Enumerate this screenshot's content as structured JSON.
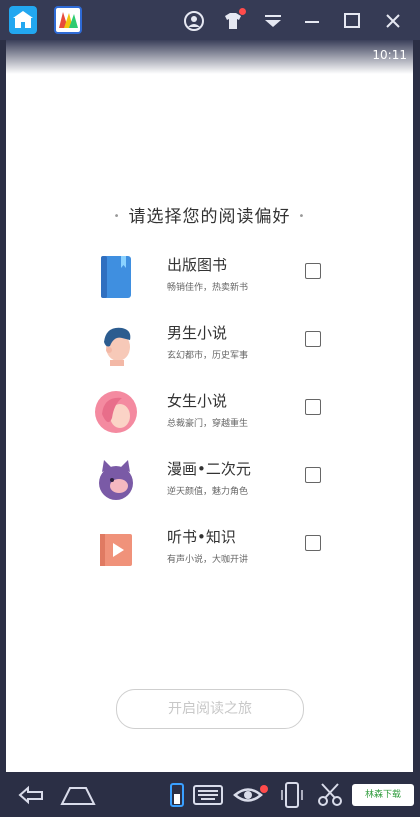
{
  "status_bar": {
    "time": "10:11"
  },
  "page": {
    "heading": "请选择您的阅读偏好",
    "heading_bullet": "•"
  },
  "options": [
    {
      "title": "出版图书",
      "subtitle": "畅销佳作，热卖新书",
      "checked": false,
      "icon": "book-icon"
    },
    {
      "title": "男生小说",
      "subtitle": "玄幻都市，历史军事",
      "checked": false,
      "icon": "male-avatar-icon"
    },
    {
      "title": "女生小说",
      "subtitle": "总裁豪门，穿越重生",
      "checked": false,
      "icon": "female-avatar-icon"
    },
    {
      "title": "漫画•二次元",
      "subtitle": "逆天颜值，魅力角色",
      "checked": false,
      "icon": "anime-character-icon"
    },
    {
      "title": "听书•知识",
      "subtitle": "有声小说，大咖开讲",
      "checked": false,
      "icon": "audiobook-icon"
    }
  ],
  "start_button": {
    "label": "开启阅读之旅"
  },
  "branding": {
    "label": "林森下载"
  },
  "colors": {
    "topbar": "#363b55",
    "home_tab": "#22a7f0",
    "book_blue": "#3f8fe0",
    "female_pink": "#f48aa0",
    "anime_purple": "#7a5aa6",
    "audio_orange": "#f0927a"
  }
}
